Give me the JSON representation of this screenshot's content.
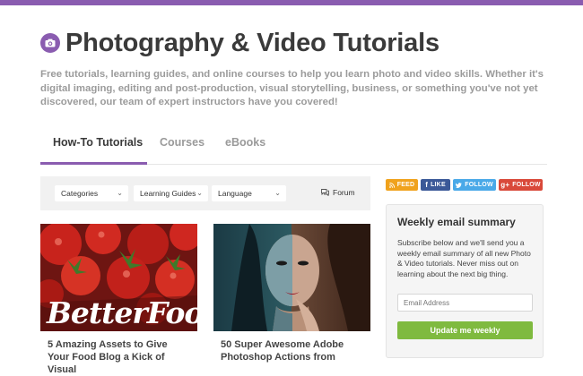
{
  "header": {
    "title": "Photography & Video Tutorials",
    "description": "Free tutorials, learning guides, and online courses to help you learn photo and video skills. Whether it's digital imaging, editing and post-production, visual storytelling, business, or something you've not yet discovered, our team of expert instructors have you covered!",
    "icon": "camera-icon",
    "accent": "#8a5cb0"
  },
  "tabs": [
    {
      "label": "How-To Tutorials",
      "active": true
    },
    {
      "label": "Courses",
      "active": false
    },
    {
      "label": "eBooks",
      "active": false
    }
  ],
  "filters": {
    "categories": "Categories",
    "learning_guides": "Learning Guides",
    "language": "Language",
    "forum": "Forum"
  },
  "social": {
    "feed": "FEED",
    "like": "LIKE",
    "twitter_follow": "FOLLOW",
    "google_follow": "FOLLOW",
    "feed_color": "#f0a21c",
    "like_color": "#3b5998",
    "twitter_color": "#4aa9e8",
    "google_color": "#d9493a"
  },
  "cards": [
    {
      "title": "5 Amazing Assets to Give Your Food Blog a Kick of Visual",
      "image_text": "BetterFood"
    },
    {
      "title": "50 Super Awesome Adobe Photoshop Actions from"
    }
  ],
  "email": {
    "title": "Weekly email summary",
    "text": "Subscribe below and we'll send you a weekly email summary of all new Photo & Video tutorials. Never miss out on learning about the next big thing.",
    "placeholder": "Email Address",
    "button": "Update me weekly",
    "button_color": "#7fba3f"
  }
}
